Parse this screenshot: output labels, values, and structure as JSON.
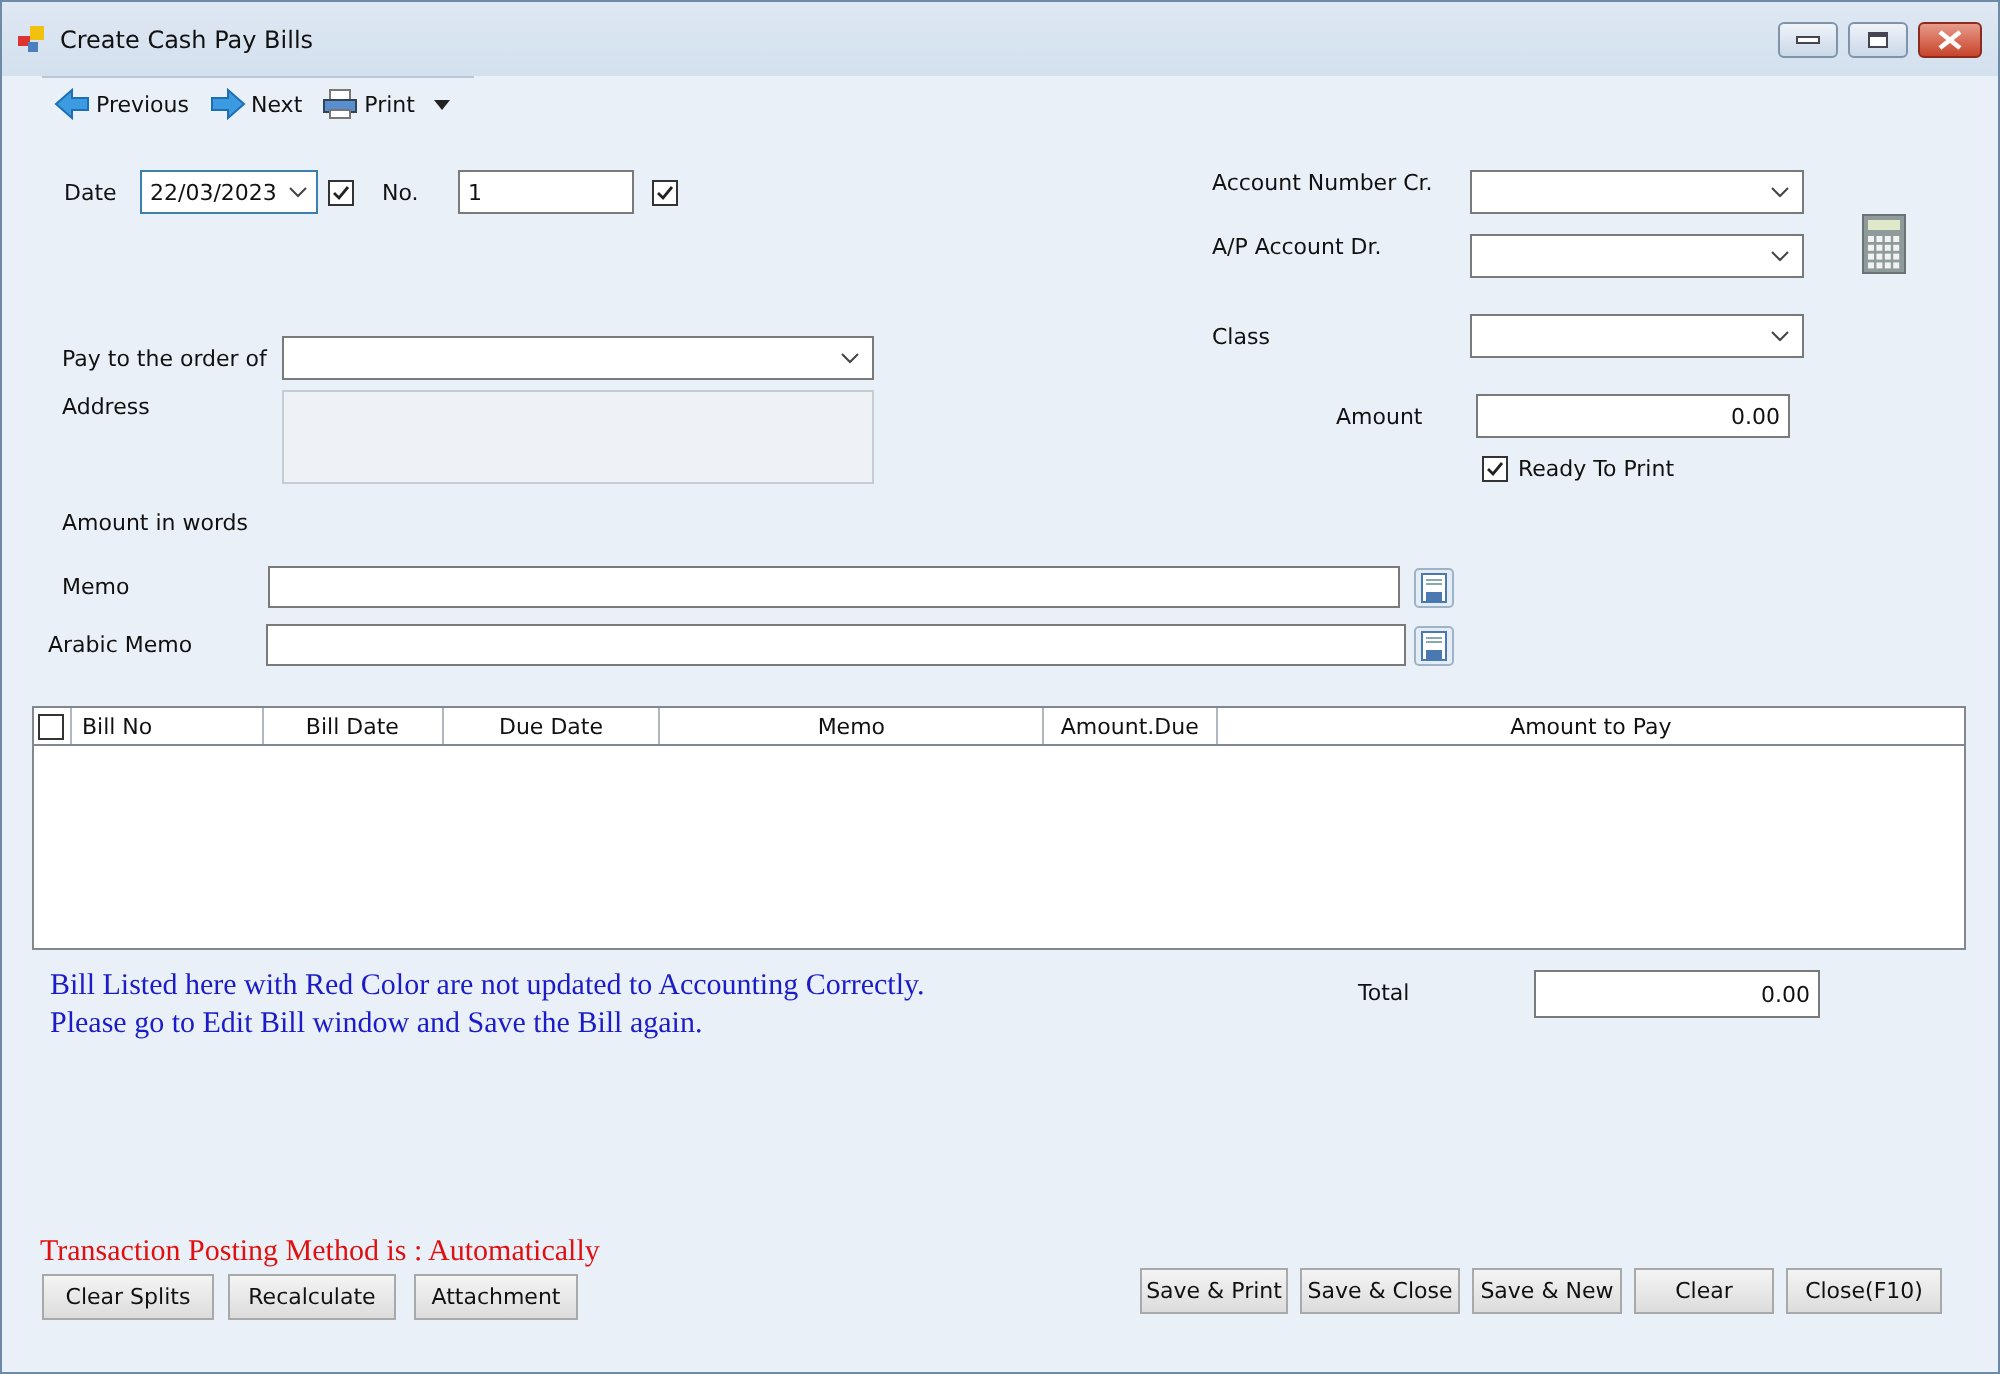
{
  "window": {
    "title": "Create Cash Pay Bills"
  },
  "toolbar": [
    {
      "label": "Previous",
      "kind": "prev"
    },
    {
      "label": "Next",
      "kind": "next"
    },
    {
      "label": "Print",
      "kind": "print"
    }
  ],
  "header": {
    "date_label": "Date",
    "date_value": "22/03/2023",
    "date_checked": true,
    "number_label": "No.",
    "number_value": "1",
    "number_checked": true
  },
  "payee": {
    "pay_to_label": "Pay to the order of",
    "address_label": "Address",
    "amount_words_label": "Amount in words"
  },
  "accounts": {
    "account_cr_label": "Account Number Cr.",
    "ap_account_label": "A/P Account Dr.",
    "class_label": "Class",
    "amount_label": "Amount",
    "amount_value": "0.00",
    "ready_label": "Ready To Print",
    "ready_checked": true
  },
  "memo": {
    "label": "Memo"
  },
  "arabic_memo": {
    "label": "Arabic Memo"
  },
  "table": {
    "select_all_checked": false,
    "columns": [
      "Bill No",
      "Bill Date",
      "Due Date",
      "Memo",
      "Amount.Due",
      "Amount to Pay"
    ]
  },
  "notice": [
    "Bill Listed here with Red Color are not updated to Accounting Correctly.",
    "Please go to Edit Bill window and Save the Bill again."
  ],
  "total": {
    "label": "Total",
    "value": "0.00"
  },
  "posting_method": "Transaction Posting Method is : Automatically",
  "left_buttons": [
    "Clear Splits",
    "Recalculate",
    "Attachment"
  ],
  "right_buttons": [
    "Save & Print",
    "Save & Close",
    "Save & New",
    "Clear",
    "Close(F10)"
  ]
}
